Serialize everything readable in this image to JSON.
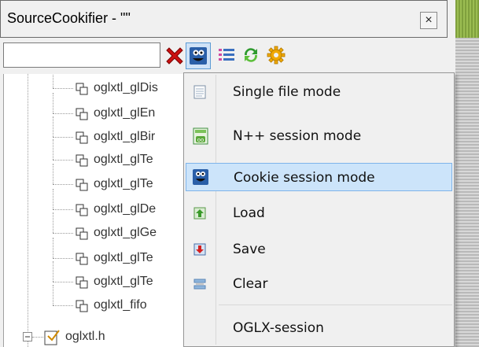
{
  "window": {
    "title": "SourceCookifier - \"\"",
    "close_glyph": "×"
  },
  "toolbar": {
    "search": {
      "value": "",
      "placeholder": ""
    },
    "buttons": [
      {
        "name": "clear-filter-icon",
        "color": "#cc1111"
      },
      {
        "name": "cookie-session-icon",
        "color": "#2a5fa8"
      },
      {
        "name": "list-view-icon",
        "color": "#d04aa0"
      },
      {
        "name": "refresh-icon",
        "color": "#2f9a2f"
      },
      {
        "name": "settings-gear-icon",
        "color": "#f0a800"
      }
    ]
  },
  "tree": {
    "items": [
      {
        "label": "oglxtl_glDis"
      },
      {
        "label": "oglxtl_glEn"
      },
      {
        "label": "oglxtl_glBir"
      },
      {
        "label": "oglxtl_glTe"
      },
      {
        "label": "oglxtl_glTe"
      },
      {
        "label": "oglxtl_glDe"
      },
      {
        "label": "oglxtl_glGe"
      },
      {
        "label": "oglxtl_glTe"
      },
      {
        "label": "oglxtl_glTe"
      },
      {
        "label": "oglxtl_fifo"
      }
    ],
    "file_label": "oglxtl.h"
  },
  "menu": {
    "items": [
      {
        "label": "Single file mode",
        "icon": "document-icon"
      },
      {
        "label": "N++ session mode",
        "icon": "npp-session-icon"
      },
      {
        "label": "Cookie session mode",
        "icon": "cookie-monster-icon",
        "selected": true
      },
      {
        "label": "Load",
        "icon": "load-arrow-icon"
      },
      {
        "label": "Save",
        "icon": "save-arrow-icon"
      },
      {
        "label": "Clear",
        "icon": "clear-eraser-icon"
      },
      {
        "label": "OGLX-session",
        "icon": ""
      }
    ]
  }
}
